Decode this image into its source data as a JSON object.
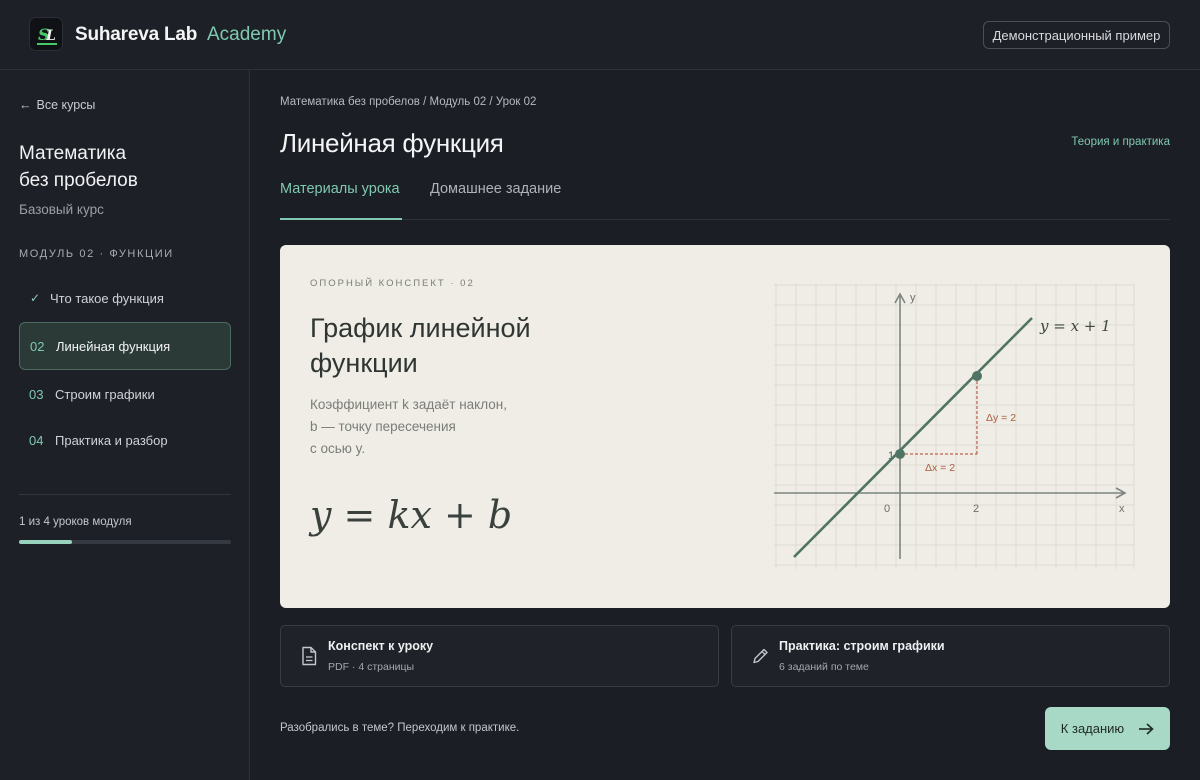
{
  "header": {
    "brand": "Suhareva Lab",
    "brand_accent": "Academy",
    "demo_button": "Демонстрационный пример"
  },
  "sidebar": {
    "back_link": "Все курсы",
    "course_title_line1": "Математика",
    "course_title_line2": "без пробелов",
    "course_subtitle": "Базовый курс",
    "module_label": "МОДУЛЬ 02 · ФУНКЦИИ",
    "lessons": [
      {
        "num": "",
        "label": "Что такое функция",
        "state": "done"
      },
      {
        "num": "02",
        "label": "Линейная функция",
        "state": "active"
      },
      {
        "num": "03",
        "label": "Строим графики",
        "state": "default"
      },
      {
        "num": "04",
        "label": "Практика и разбор",
        "state": "default"
      }
    ],
    "progress_text": "1 из 4 уроков модуля",
    "progress_fraction": 0.25
  },
  "main": {
    "breadcrumb": "Математика без пробелов / Модуль 02 / Урок 02",
    "title": "Линейная функция",
    "theory_link": "Теория и практика",
    "tabs": [
      {
        "label": "Материалы урока",
        "active": true
      },
      {
        "label": "Домашнее задание",
        "active": false
      }
    ],
    "card": {
      "eyebrow": "ОПОРНЫЙ КОНСПЕКТ · 02",
      "title_line1": "График линейной",
      "title_line2": "функции",
      "desc_line1": "Коэффициент k задаёт наклон,",
      "desc_line2": "b — точку пересечения",
      "desc_line3": "с осью y.",
      "formula": "y = kx + b",
      "graph": {
        "y_axis_label": "y",
        "x_axis_label": "x",
        "origin_label": "0",
        "x_tick_label": "2",
        "y_tick_label": "1",
        "line_label": "y = x + 1",
        "dy_label": "Δy = 2",
        "dx_label": "Δx = 2"
      }
    },
    "resources": [
      {
        "title": "Конспект к уроку",
        "subtitle": "PDF · 4 страницы",
        "icon": "document-icon"
      },
      {
        "title": "Практика: строим графики",
        "subtitle": "6 заданий по теме",
        "icon": "pencil-icon"
      }
    ],
    "footer_text": "Разобрались в теме? Переходим к практике.",
    "cta_button": "К заданию"
  },
  "colors": {
    "accent": "#7fc9b0",
    "background": "#1b1e24",
    "card_background": "#efede6",
    "graph_line": "#4f7464",
    "graph_delta": "#c0644a"
  }
}
